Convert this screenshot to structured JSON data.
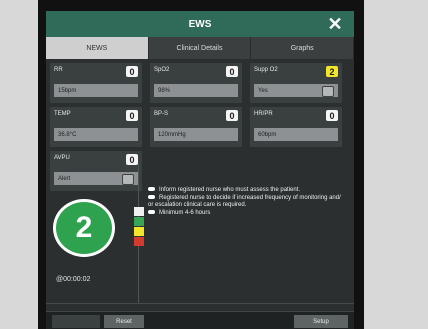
{
  "window": {
    "title": "EWS"
  },
  "tabs": [
    {
      "label": "NEWS"
    },
    {
      "label": "Clinical Details"
    },
    {
      "label": "Graphs"
    }
  ],
  "fields": [
    {
      "label": "RR",
      "score": "0",
      "value": "15bpm"
    },
    {
      "label": "SpO2",
      "score": "0",
      "value": "98%"
    },
    {
      "label": "Supp O2",
      "score": "2",
      "value": "Yes"
    },
    {
      "label": "TEMP",
      "score": "0",
      "value": "36.8°C"
    },
    {
      "label": "BP-S",
      "score": "0",
      "value": "120mmHg"
    },
    {
      "label": "HR/PR",
      "score": "0",
      "value": "60bpm"
    },
    {
      "label": "AVPU",
      "score": "0",
      "value": "Alert"
    }
  ],
  "total_score": "2",
  "timer": "@00:00:02",
  "messages": [
    "Inform registered nurse who must assess the patient.",
    "Registered nurse to decide if increased frequency of monitoring and/ or escalation clinical care is required.",
    "Minimum 4-6 hours"
  ],
  "buttons": {
    "left": "",
    "reset": "Reset",
    "setup": "Setup"
  },
  "colors": {
    "titlebar": "#2f6b58",
    "score_circle": "#2fa24f",
    "scale_white": "#f0f0f0",
    "scale_green": "#3aa655",
    "scale_yellow": "#f3e52a",
    "scale_red": "#d33b2f"
  }
}
